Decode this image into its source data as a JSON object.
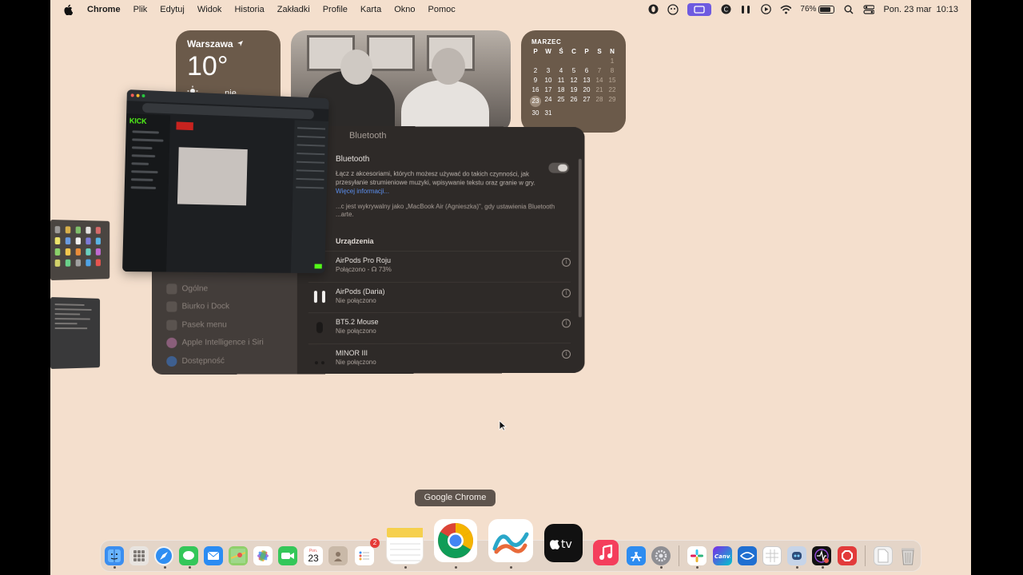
{
  "menubar": {
    "app_name": "Chrome",
    "menus": [
      "Plik",
      "Edytuj",
      "Widok",
      "Historia",
      "Zakładki",
      "Profile",
      "Karta",
      "Okno",
      "Pomoc"
    ],
    "battery_percent": "76%",
    "datetime": "Pon. 23 mar  10:13",
    "status_icons": [
      "opera-icon",
      "face-icon",
      "screen-share-icon",
      "circle-c-icon",
      "airpods-icon",
      "play-icon",
      "wifi-icon",
      "battery-icon",
      "search-icon",
      "control-center-icon"
    ]
  },
  "weather_widget": {
    "city": "Warszawa",
    "temperature": "10°",
    "condition_partial": "...nie"
  },
  "calendar_widget": {
    "month": "MARZEC",
    "weekdays": [
      "P",
      "W",
      "Ś",
      "C",
      "P",
      "S",
      "N"
    ],
    "weeks": [
      [
        "",
        "",
        "",
        "",
        "",
        "",
        "1"
      ],
      [
        "2",
        "3",
        "4",
        "5",
        "6",
        "7",
        "8"
      ],
      [
        "9",
        "10",
        "11",
        "12",
        "13",
        "14",
        "15"
      ],
      [
        "16",
        "17",
        "18",
        "19",
        "20",
        "21",
        "22"
      ],
      [
        "23",
        "24",
        "25",
        "26",
        "27",
        "28",
        "29"
      ],
      [
        "30",
        "31",
        "",
        "",
        "",
        "",
        ""
      ]
    ],
    "today": "23"
  },
  "settings_window": {
    "title": "Bluetooth",
    "bluetooth_label": "Bluetooth",
    "bluetooth_desc": "Łącz z akcesoriami, których możesz używać do takich czynności, jak przesyłanie strumieniowe muzyki, wpisywanie tekstu oraz granie w gry.",
    "more_info": "Więcej informacji...",
    "discoverable_note": "...c jest wykrywalny jako „MacBook Air (Agnieszka)\", gdy ustawienia Bluetooth ...arte.",
    "devices_header": "Urządzenia",
    "devices": [
      {
        "name": "AirPods Pro Roju",
        "status": "Połączono - ☊ 73%"
      },
      {
        "name": "AirPods (Daria)",
        "status": "Nie połączono"
      },
      {
        "name": "BT5.2 Mouse",
        "status": "Nie połączono"
      },
      {
        "name": "MINOR III",
        "status": "Nie połączono"
      }
    ],
    "sidebar": [
      "Ogólne",
      "Biurko i Dock",
      "Pasek menu",
      "Apple Intelligence i Siri",
      "Dostępność"
    ]
  },
  "chrome_preview": {
    "logo": "KICK"
  },
  "dock": {
    "tooltip": "Google Chrome",
    "reminders_badge": "2",
    "calendar_month": "Pon.",
    "calendar_day": "23",
    "apps": [
      "finder",
      "launchpad",
      "safari",
      "messages",
      "mail",
      "maps",
      "photos",
      "facetime",
      "calendar",
      "contacts",
      "reminders",
      "notes",
      "chrome",
      "freeform",
      "appletv",
      "music",
      "appstore",
      "system-settings",
      "slack",
      "canva",
      "mercury",
      "spreadsheet",
      "robot",
      "activity",
      "stop",
      "document",
      "trash"
    ]
  }
}
